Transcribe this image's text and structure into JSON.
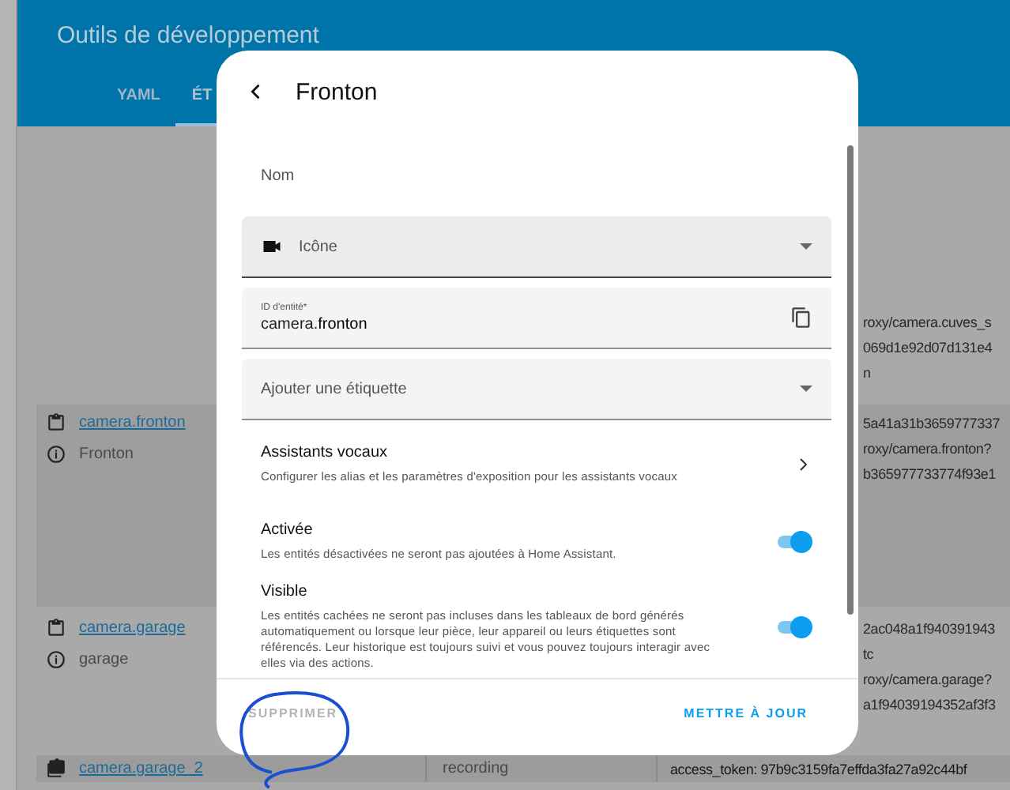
{
  "app_bar": {
    "title": "Outils de développement",
    "tabs": [
      {
        "label": "YAML",
        "selected": false
      },
      {
        "label": "ÉT",
        "selected": true
      }
    ]
  },
  "background_rows": [
    {
      "attributes": [
        "roxy/camera.cuves_s",
        "069d1e92d07d131e4",
        "n"
      ]
    },
    {
      "entity": "camera.fronton",
      "name": "Fronton",
      "highlighted": true,
      "attributes": [
        "5a41a31b3659777337",
        "roxy/camera.fronton?",
        "b365977733774f93e1"
      ]
    },
    {
      "entity": "camera.garage",
      "name": "garage",
      "highlighted": false,
      "attributes": [
        "2ac048a1f940391943",
        "tc",
        "roxy/camera.garage?",
        "a1f94039194352af3f3"
      ]
    },
    {
      "entity": "camera.garage_2",
      "state": "recording",
      "highlighted": true,
      "attributes": [
        "access_token: 97b9c3159fa7effda3fa27a92c44bf"
      ]
    }
  ],
  "dialog": {
    "title": "Fronton",
    "fields": [
      {
        "kind": "text",
        "placeholder": "Nom"
      },
      {
        "kind": "icon-select",
        "label": "Icône"
      },
      {
        "kind": "id",
        "label": "ID d'entité*",
        "prefix": "camera.",
        "value": "fronton"
      },
      {
        "kind": "select",
        "label": "Ajouter une étiquette"
      }
    ],
    "settings": [
      {
        "kind": "link",
        "title": "Assistants vocaux",
        "description": "Configurer les alias et les paramètres d'exposition pour les assistants vocaux"
      },
      {
        "kind": "toggle",
        "title": "Activée",
        "description": "Les entités désactivées ne seront pas ajoutées à Home Assistant.",
        "on": true
      },
      {
        "kind": "toggle",
        "title": "Visible",
        "description": "Les entités cachées ne seront pas incluses dans les tableaux de bord générés automatiquement ou lorsque leur pièce, leur appareil ou leurs étiquettes sont référencés. Leur historique est toujours suivi et vous pouvez toujours interagir avec elles via des actions.",
        "on": true
      }
    ],
    "delete_button": {
      "label": "SUPPRIMER",
      "disabled": true
    },
    "update_button": {
      "label": "METTRE À JOUR",
      "disabled": false
    }
  }
}
